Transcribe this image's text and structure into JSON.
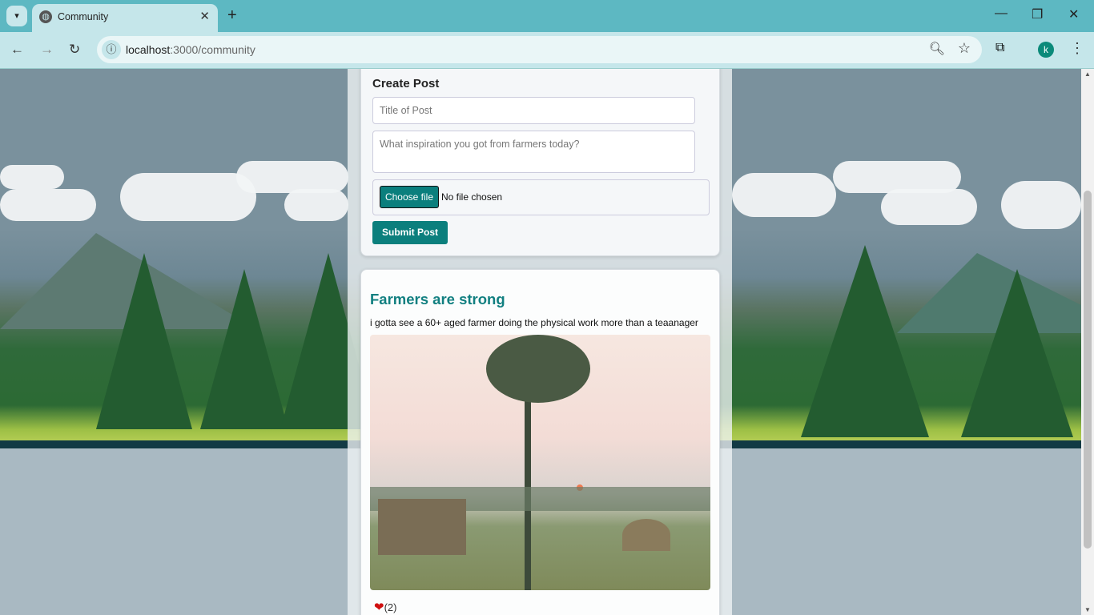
{
  "browser": {
    "tab_title": "Community",
    "url_host": "localhost",
    "url_path": ":3000/community",
    "profile_initial": "k"
  },
  "create_post": {
    "heading": "Create Post",
    "title_placeholder": "Title of Post",
    "body_placeholder": "What inspiration you got from farmers today?",
    "choose_file_label": "Choose file",
    "file_status": "No file chosen",
    "submit_label": "Submit Post"
  },
  "posts": [
    {
      "title": "Farmers are strong",
      "body": "i gotta see a 60+ aged farmer doing the physical work more than a teaanager",
      "like_count": "(2)"
    }
  ],
  "colors": {
    "accent": "#0b7f7d",
    "title": "#117f80",
    "browser_frame": "#5db8c2"
  }
}
